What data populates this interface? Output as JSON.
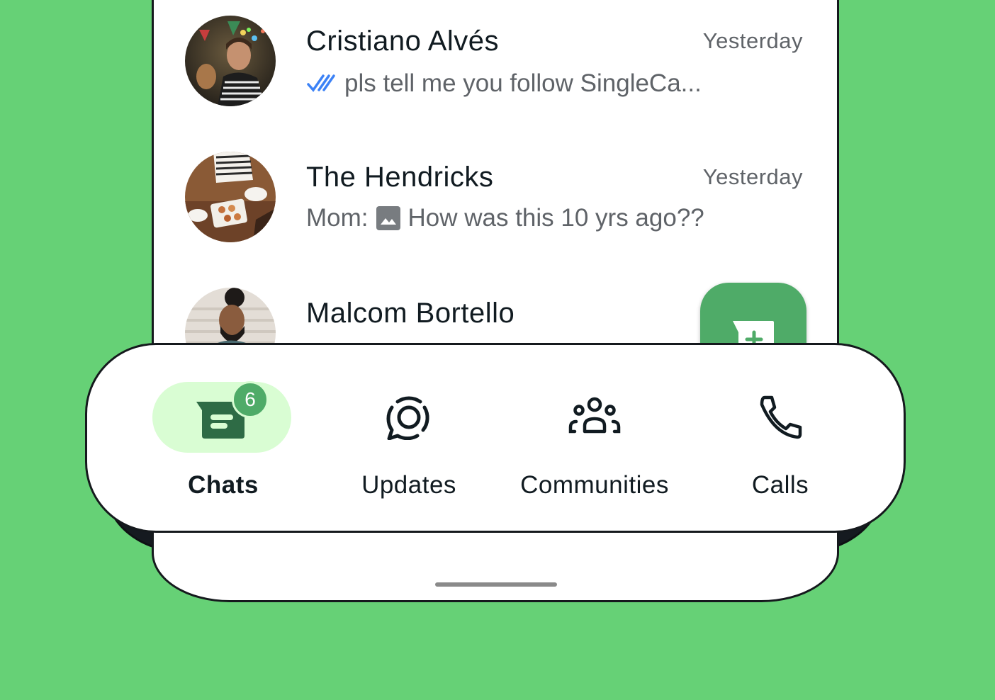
{
  "chats": [
    {
      "name": "Cristiano Alvés",
      "time": "Yesterday",
      "preview": "pls tell me you follow SingleCa...",
      "status_icon": "double-check-read-icon",
      "read_color": "#3c82f6"
    },
    {
      "name": "The Hendricks",
      "time": "Yesterday",
      "sender": "Mom:",
      "media_icon": "image-icon",
      "preview": "How was this 10 yrs ago??"
    },
    {
      "name": "Malcom Bortello",
      "time": "",
      "preview": ""
    }
  ],
  "fab": {
    "icon": "new-chat-icon"
  },
  "nav": {
    "items": [
      {
        "label": "Chats",
        "icon": "chats-icon",
        "active": true,
        "badge": "6"
      },
      {
        "label": "Updates",
        "icon": "updates-icon",
        "active": false
      },
      {
        "label": "Communities",
        "icon": "communities-icon",
        "active": false
      },
      {
        "label": "Calls",
        "icon": "calls-icon",
        "active": false
      }
    ]
  },
  "colors": {
    "background": "#66d176",
    "accent": "#4fab68",
    "active_pill": "#d9fdd3",
    "chat_icon_dark": "#2e6b45"
  }
}
